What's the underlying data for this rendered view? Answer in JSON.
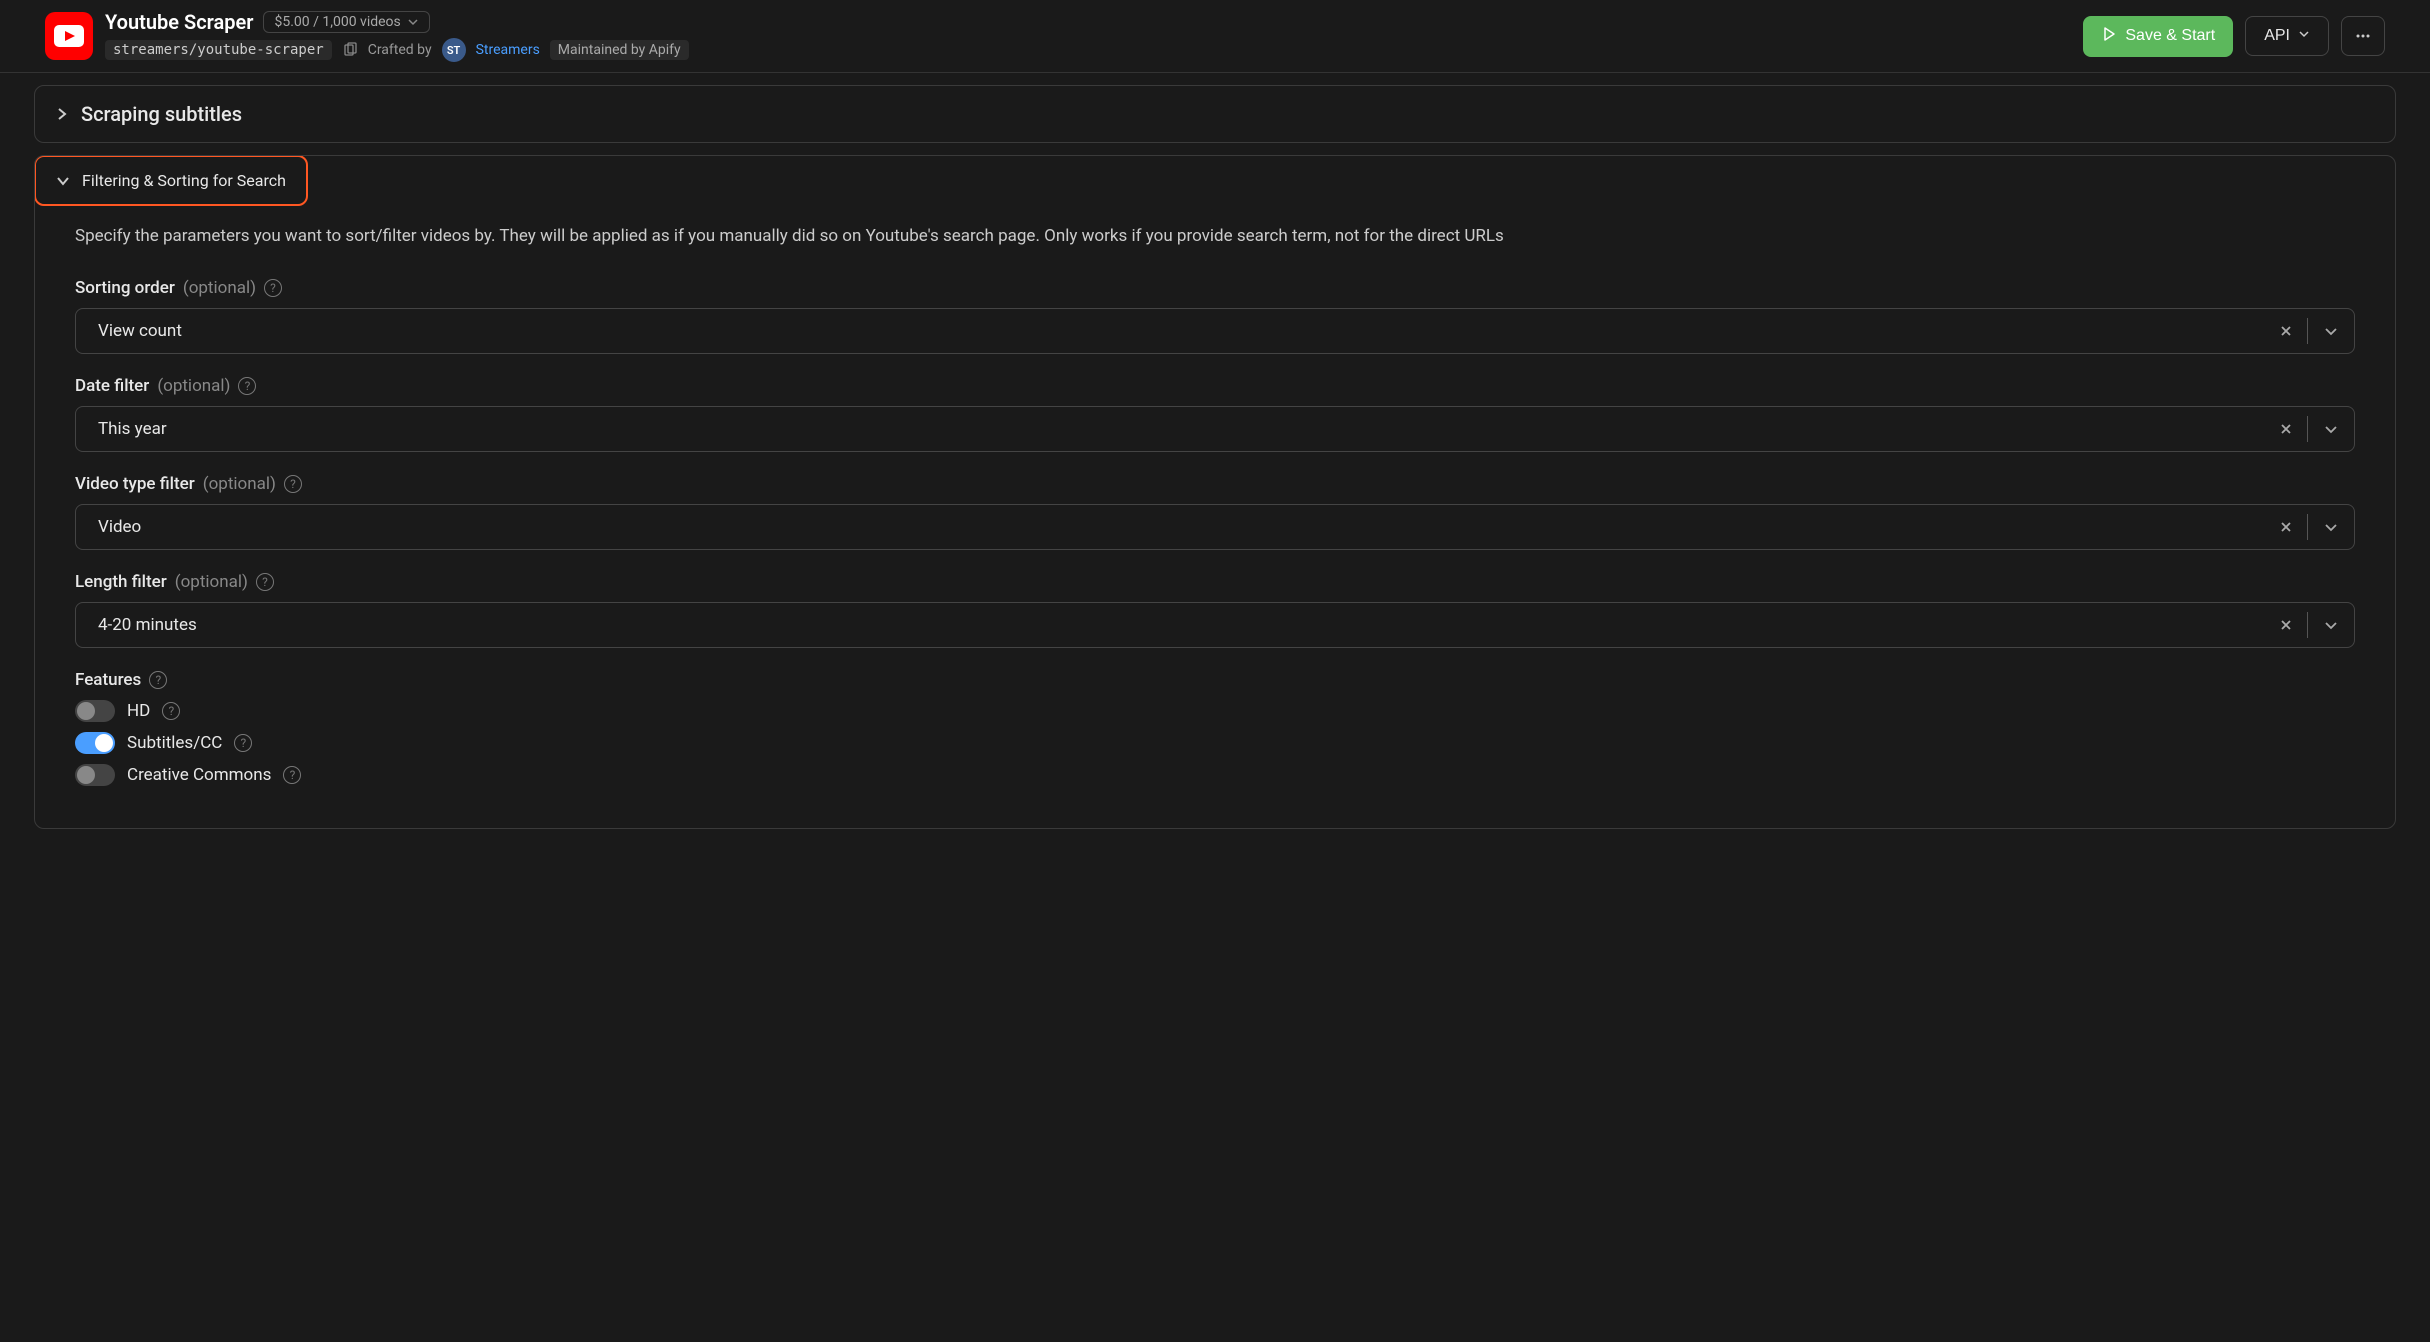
{
  "header": {
    "title": "Youtube Scraper",
    "pricing": "$5.00 / 1,000 videos",
    "slug": "streamers/youtube-scraper",
    "crafted_by_label": "Crafted by",
    "author_initials": "ST",
    "author_name": "Streamers",
    "maintainer": "Maintained by Apify",
    "save_button": "Save & Start",
    "api_button": "API"
  },
  "panels": {
    "subtitles": {
      "title": "Scraping subtitles"
    },
    "filtering": {
      "title": "Filtering & Sorting for Search",
      "description": "Specify the parameters you want to sort/filter videos by. They will be applied as if you manually did so on Youtube's search page. Only works if you provide search term, not for the direct URLs"
    }
  },
  "fields": {
    "sorting_order": {
      "label": "Sorting order",
      "optional": "(optional)",
      "value": "View count"
    },
    "date_filter": {
      "label": "Date filter",
      "optional": "(optional)",
      "value": "This year"
    },
    "video_type": {
      "label": "Video type filter",
      "optional": "(optional)",
      "value": "Video"
    },
    "length_filter": {
      "label": "Length filter",
      "optional": "(optional)",
      "value": "4-20 minutes"
    },
    "features": {
      "label": "Features",
      "items": [
        {
          "label": "HD",
          "enabled": false
        },
        {
          "label": "Subtitles/CC",
          "enabled": true
        },
        {
          "label": "Creative Commons",
          "enabled": false
        }
      ]
    }
  }
}
